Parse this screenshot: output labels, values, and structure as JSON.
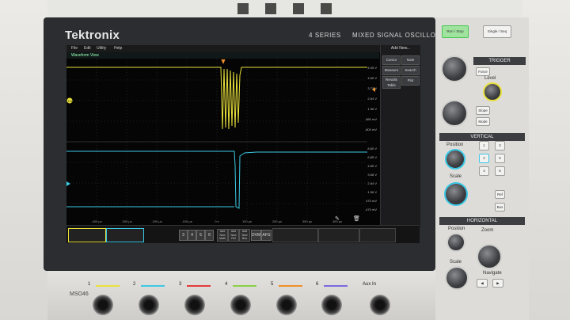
{
  "brand": "Tektronix",
  "series": "4 SERIES",
  "product": "MIXED SIGNAL OSCILLOSCOPE",
  "model": "MSO46",
  "menu": [
    "File",
    "Edit",
    "Utility",
    "Help"
  ],
  "waveform_title": "Waveform View",
  "add_new_label": "Add New...",
  "side_buttons": [
    "Cursor",
    "Note",
    "Measure",
    "Search",
    "Results Table",
    "Plot"
  ],
  "y_ticks_upper": [
    "4.95 V",
    "4.65 V",
    "3.72 V",
    "2.84 V",
    "1.96 V",
    "880 mV",
    "-800 mV"
  ],
  "y_ticks_lower": [
    "8.80 V",
    "6.85 V",
    "4.85 V",
    "3.68 V",
    "2.84 V",
    "1.96 V",
    "470 mV",
    "-470 mV"
  ],
  "x_ticks": [
    "-400 µs",
    "-300 µs",
    "-200 µs",
    "-100 µs",
    "0 s",
    "100 µs",
    "200 µs",
    "300 µs",
    "400 µs"
  ],
  "badge_bar": {
    "ch_buttons": [
      "3",
      "4",
      "5",
      "6"
    ],
    "add_buttons": [
      "Add New Math",
      "Add New Ref",
      "Add New Bus"
    ],
    "dvm": "DVM",
    "afg": "AFG",
    "run_stop": "Stop"
  },
  "panel": {
    "run_stop": "Run / Stop",
    "single_seq": "Single / Seq",
    "trigger": "TRIGGER",
    "force": "Force",
    "level": "Level",
    "slope": "Slope",
    "mode": "Mode",
    "vertical": "VERTICAL",
    "position": "Position",
    "scale": "Scale",
    "ref": "Ref",
    "bus": "Bus",
    "horizontal": "HORIZONTAL",
    "zoom": "Zoom",
    "navigate": "Navigate",
    "ch_keys": [
      "1",
      "2",
      "3",
      "4",
      "5",
      "6"
    ]
  },
  "inputs": [
    "1",
    "2",
    "3",
    "4",
    "5",
    "6",
    "Aux In"
  ],
  "colors": {
    "ch1": "#e8e13a",
    "ch2": "#3cc8e6",
    "ch3": "#e23a3a",
    "ch4": "#8ad14a",
    "ch5": "#f0902a",
    "ch6": "#7a6ae0",
    "run_green": "#49c552"
  }
}
